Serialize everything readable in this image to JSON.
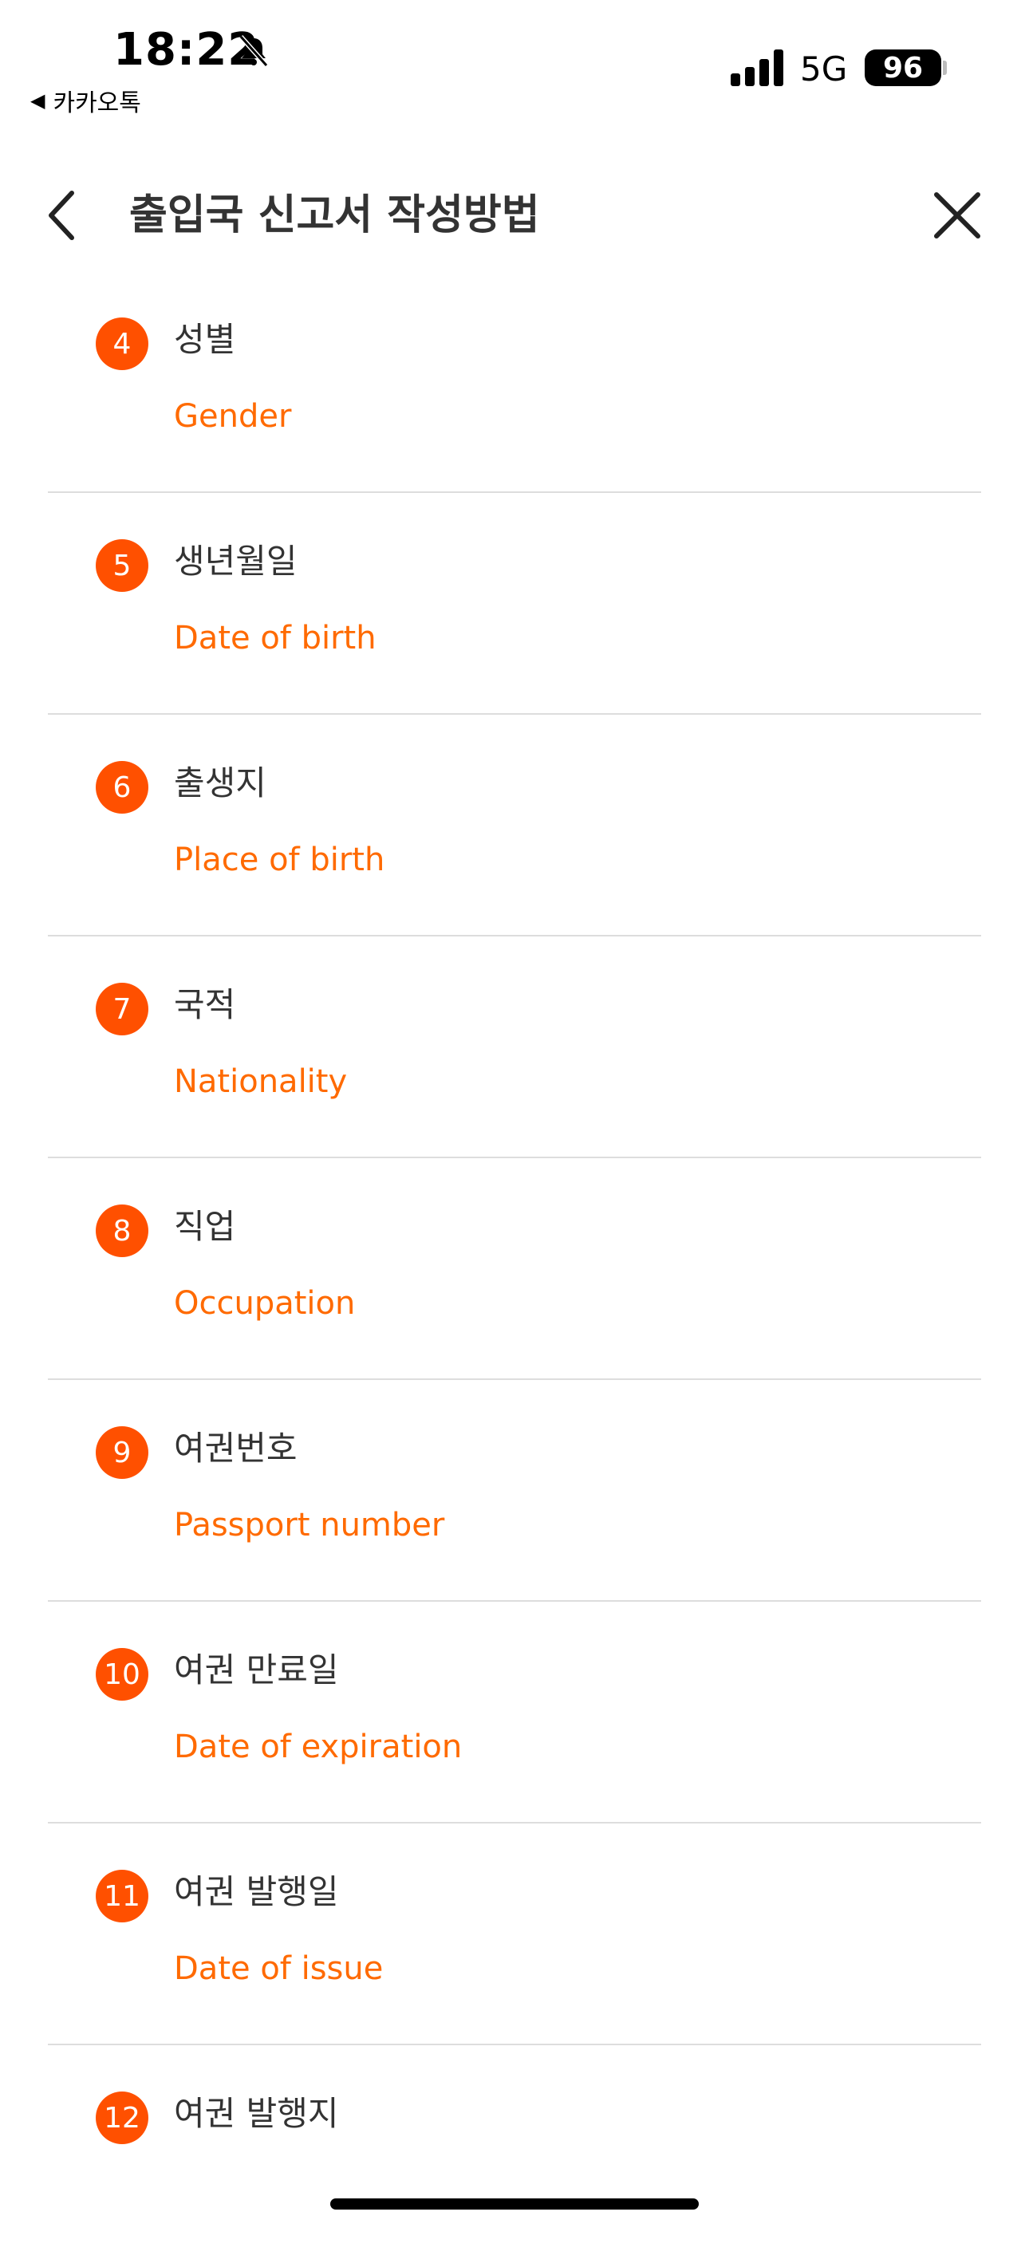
{
  "status_bar": {
    "time": "18:22",
    "back_app": "카카오톡",
    "network": "5G",
    "battery": "96"
  },
  "header": {
    "title": "출입국 신고서 작성방법"
  },
  "items": [
    {
      "number": "4",
      "ko": "성별",
      "en": "Gender"
    },
    {
      "number": "5",
      "ko": "생년월일",
      "en": "Date of birth"
    },
    {
      "number": "6",
      "ko": "출생지",
      "en": "Place of birth"
    },
    {
      "number": "7",
      "ko": "국적",
      "en": "Nationality"
    },
    {
      "number": "8",
      "ko": "직업",
      "en": "Occupation"
    },
    {
      "number": "9",
      "ko": "여권번호",
      "en": "Passport number"
    },
    {
      "number": "10",
      "ko": "여권 만료일",
      "en": "Date of expiration"
    },
    {
      "number": "11",
      "ko": "여권 발행일",
      "en": "Date of issue"
    },
    {
      "number": "12",
      "ko": "여권 발행지",
      "en": ""
    }
  ],
  "colors": {
    "accent": "#ff5000",
    "accent_text": "#ff6a00",
    "divider": "#dddddd"
  }
}
